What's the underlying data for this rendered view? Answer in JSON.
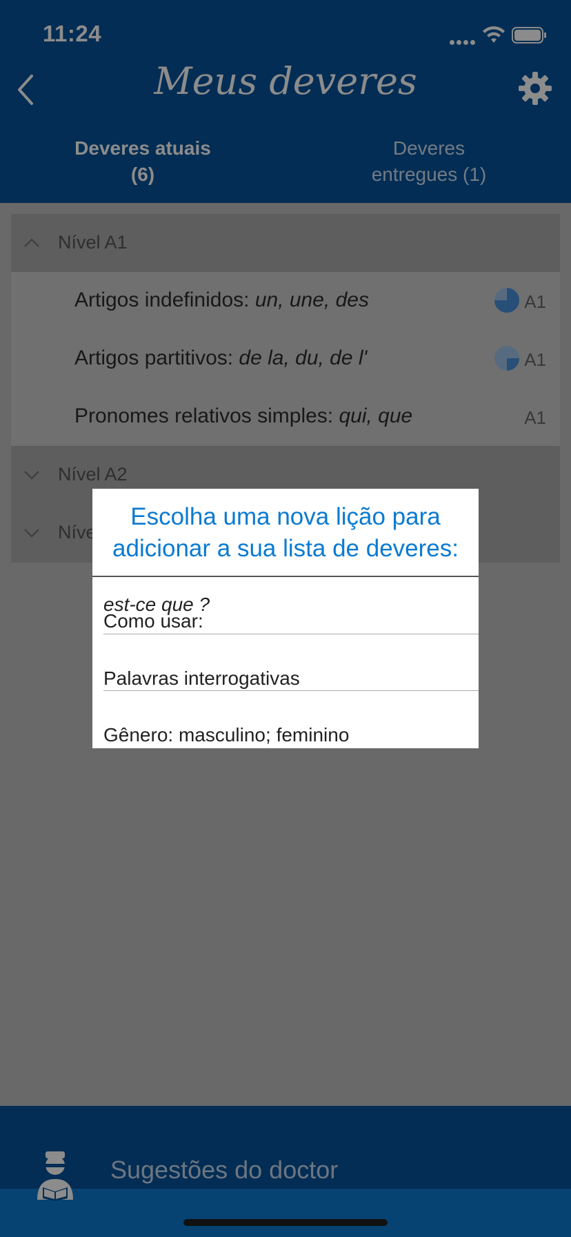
{
  "status_bar": {
    "time": "11:24"
  },
  "header": {
    "title": "Meus deveres",
    "tabs": [
      {
        "label": "Deveres atuais\n(6)",
        "line1": "Deveres atuais",
        "line2": "(6)"
      },
      {
        "label": "Deveres entregues (1)",
        "line1": "Deveres",
        "line2": "entregues (1)"
      }
    ]
  },
  "levels": [
    {
      "label": "Nível A1",
      "expanded": true,
      "lessons": [
        {
          "prefix": "Artigos indefinidos: ",
          "italic": "un, une, des",
          "level": "A1",
          "progress": 0.75
        },
        {
          "prefix": "Artigos partitivos: ",
          "italic": "de la, du, de l'",
          "level": "A1",
          "progress": 0.25
        },
        {
          "prefix": "Pronomes relativos simples: ",
          "italic": "qui, que",
          "level": "A1",
          "progress": 0
        }
      ]
    },
    {
      "label": "Nível A2",
      "expanded": false
    },
    {
      "label": "Níve",
      "expanded": false
    }
  ],
  "dialog": {
    "title_line1": "Escolha uma nova lição para",
    "title_line2": "adicionar a sua lista de deveres:",
    "options": [
      {
        "prefix": "Como usar: ",
        "italic": "est-ce que ?"
      },
      {
        "prefix": "Palavras interrogativas",
        "italic": ""
      },
      {
        "prefix": "Gênero: masculino; feminino",
        "italic": ""
      }
    ]
  },
  "bottom_bar": {
    "label": "Sugestões do doctor"
  },
  "colors": {
    "header": "#06529a",
    "accent": "#0b7ad1",
    "pie": "#4a90d9"
  }
}
